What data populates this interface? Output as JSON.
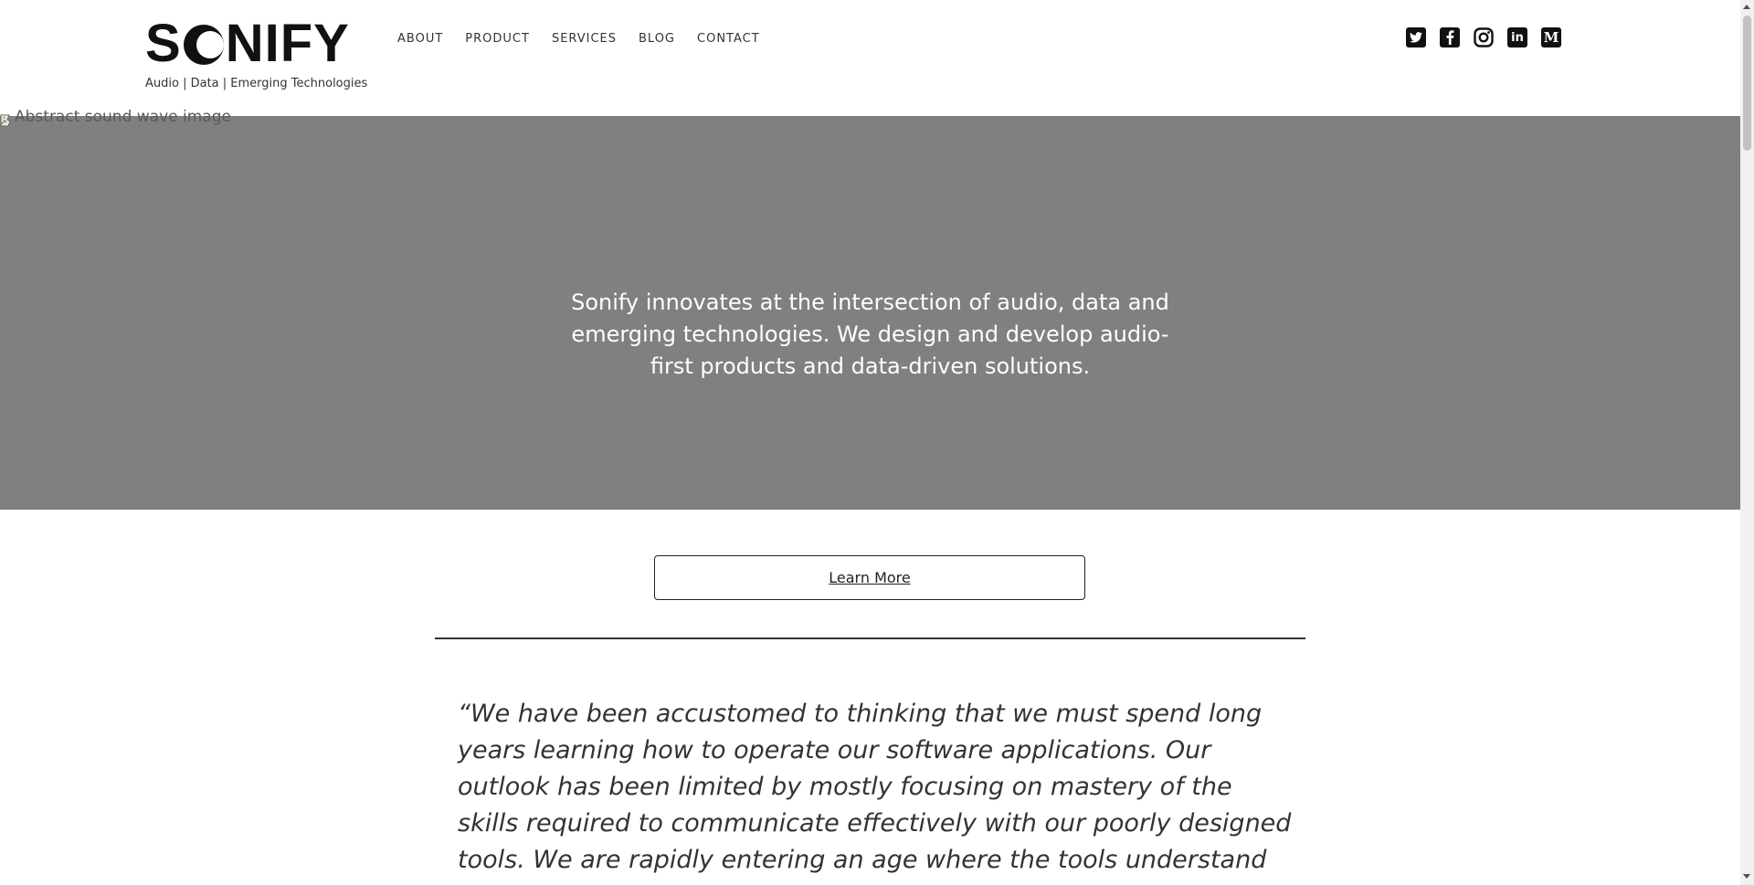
{
  "header": {
    "logo_text_left": "S",
    "logo_text_right": "NIFY",
    "tagline": "Audio | Data | Emerging Technologies",
    "nav": [
      {
        "label": "ABOUT"
      },
      {
        "label": "PRODUCT"
      },
      {
        "label": "SERVICES"
      },
      {
        "label": "BLOG"
      },
      {
        "label": "CONTACT"
      }
    ],
    "social": [
      {
        "icon": "twitter-icon"
      },
      {
        "icon": "facebook-icon"
      },
      {
        "icon": "instagram-icon"
      },
      {
        "icon": "linkedin-icon",
        "glyph": "in"
      },
      {
        "icon": "medium-icon",
        "glyph": "M"
      }
    ]
  },
  "hero": {
    "image_alt": "Abstract sound wave image",
    "text": "Sonify innovates at the intersection of audio, data and emerging technologies. We design and develop audio-first products and data-driven solutions.",
    "background": "#808080"
  },
  "cta": {
    "label": "Learn More"
  },
  "quote": {
    "text": "“We have been accustomed to thinking that we must spend long years learning how to operate our software applications. Our outlook has been limited by mostly focusing on mastery of the skills required to communicate effectively with our poorly designed tools. We are rapidly entering an age where the tools understand us and can move"
  }
}
